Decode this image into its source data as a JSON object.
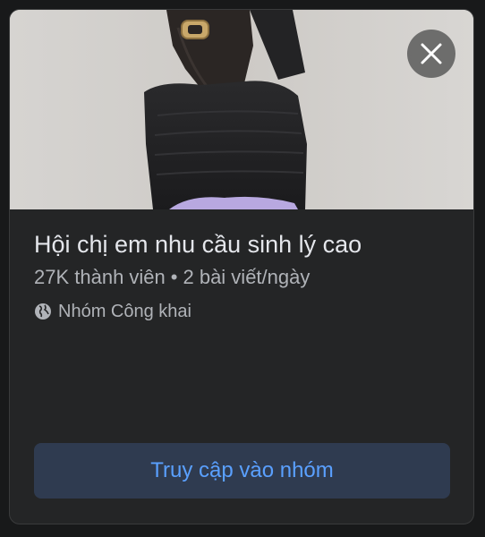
{
  "group": {
    "name": "Hội chị em nhu cầu sinh lý cao",
    "members": "27K thành viên",
    "separator": "•",
    "posts": "2 bài viết/ngày",
    "privacy": "Nhóm Công khai"
  },
  "actions": {
    "visit_label": "Truy cập vào nhóm"
  },
  "icons": {
    "close": "close-icon",
    "privacy": "globe-icon"
  },
  "colors": {
    "card_bg": "#242526",
    "button_bg": "#2f3b50",
    "button_text": "#5aa0ff",
    "primary_text": "#e4e6eb",
    "secondary_text": "#b0b3b8"
  }
}
